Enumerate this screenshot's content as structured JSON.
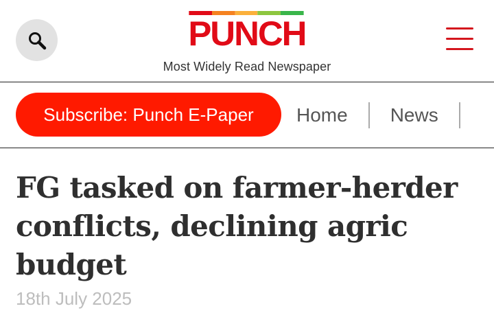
{
  "header": {
    "logo_text": "PUNCH",
    "tagline": "Most Widely Read Newspaper",
    "logo_bar_colors": [
      "#e10b17",
      "#f58220",
      "#fbb03b",
      "#8dc63f",
      "#39b54a"
    ],
    "search_icon": "search-icon",
    "menu_icon": "hamburger-menu-icon"
  },
  "nav": {
    "subscribe_label": "Subscribe: Punch E-Paper",
    "subscribe_color": "#ff1a00",
    "links": [
      {
        "label": "Home"
      },
      {
        "label": "News"
      }
    ]
  },
  "article": {
    "headline": "FG tasked on farmer-herder conflicts, declining agric budget",
    "date": "18th July 2025"
  }
}
